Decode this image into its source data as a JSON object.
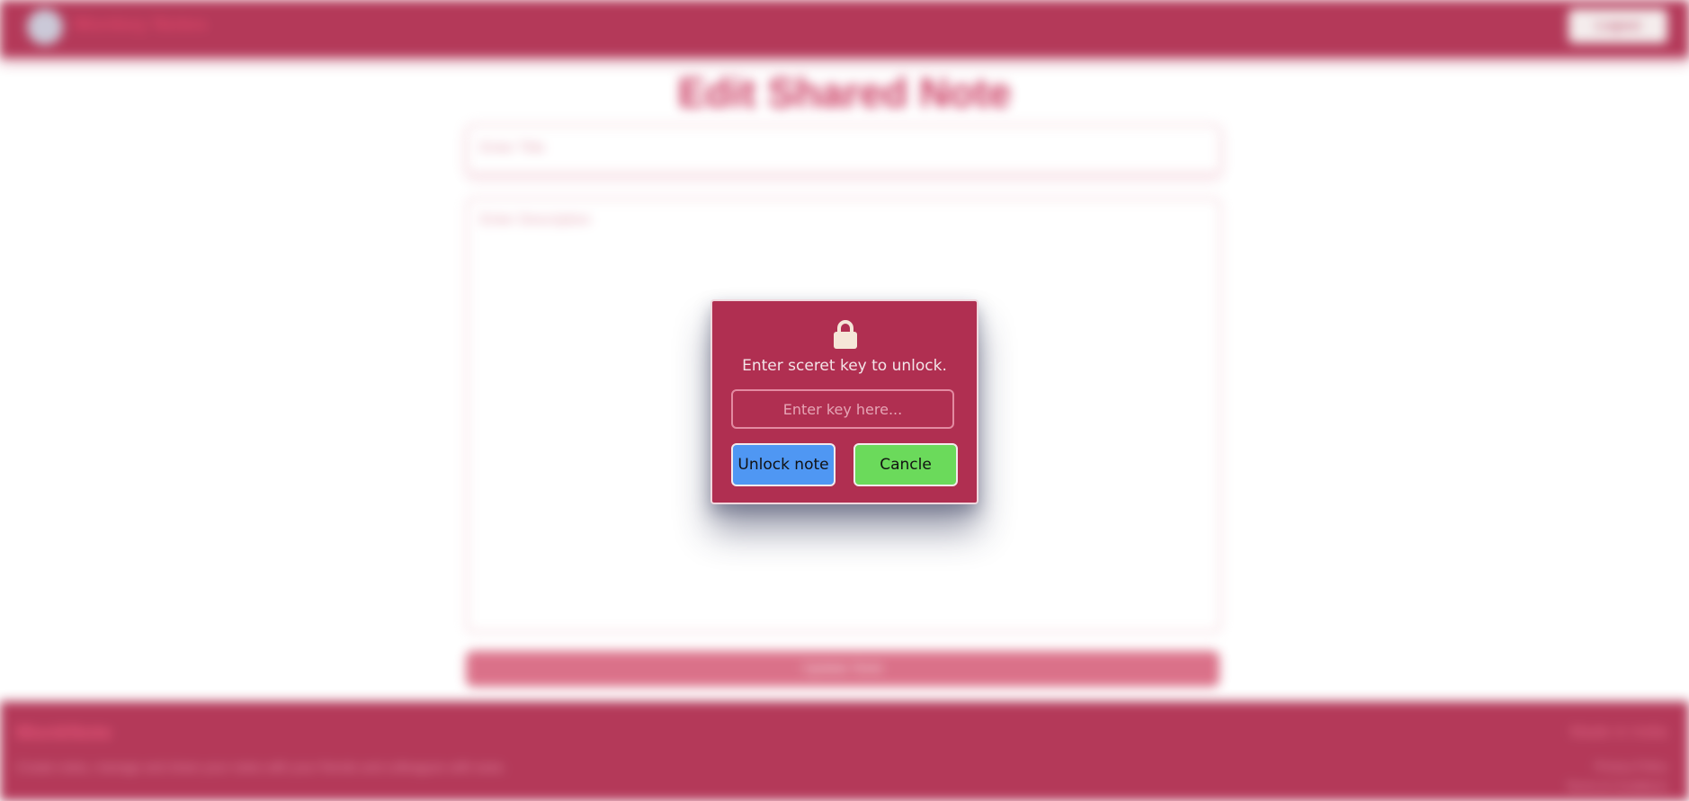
{
  "header": {
    "brand": "Monkey Notes",
    "button_label": "Logout"
  },
  "main": {
    "title": "Edit Shared Note",
    "title_placeholder": "Enter Title",
    "description_placeholder": "Enter Description",
    "save_label": "Update Note"
  },
  "footer": {
    "heading": "MonkNote",
    "text": "Create notes, manage and share your notes with your friends and colleagues with ease.",
    "right_heading": "Made in India",
    "right_line1": "Privacy Policy",
    "right_line2": "Terms & Conditions"
  },
  "modal": {
    "icon": "lock-icon",
    "message": "Enter sceret key to unlock.",
    "input_placeholder": "Enter key here...",
    "unlock_label": "Unlock note",
    "cancel_label": "Cancle"
  },
  "colors": {
    "primary": "#b02f51",
    "unlock": "#4f97f3",
    "cancel": "#6bda5b",
    "lock": "#f5e6d8"
  }
}
